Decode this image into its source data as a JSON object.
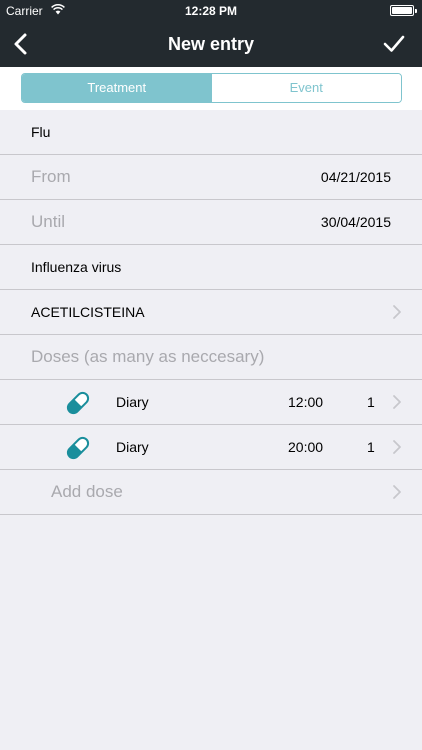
{
  "status": {
    "carrier": "Carrier",
    "time": "12:28 PM"
  },
  "nav": {
    "title": "New entry",
    "back_icon": "chevron-left-icon",
    "confirm_icon": "checkmark-icon"
  },
  "segments": [
    {
      "label": "Treatment",
      "active": true
    },
    {
      "label": "Event",
      "active": false
    }
  ],
  "fields": {
    "name": "Flu",
    "from_label": "From",
    "from_value": "04/21/2015",
    "until_label": "Until",
    "until_value": "30/04/2015",
    "cause": "Influenza virus",
    "medication": "ACETILCISTEINA",
    "doses_label": "Doses (as many as neccesary)"
  },
  "doses": [
    {
      "frequency": "Diary",
      "time": "12:00",
      "quantity": "1"
    },
    {
      "frequency": "Diary",
      "time": "20:00",
      "quantity": "1"
    }
  ],
  "add_dose_label": "Add dose",
  "colors": {
    "navbar": "#232a2f",
    "accent": "#7fc4ce",
    "pill": "#1a8e9c",
    "background": "#efeff4",
    "separator": "#c8c7cc",
    "placeholder": "#a9a9ae"
  }
}
